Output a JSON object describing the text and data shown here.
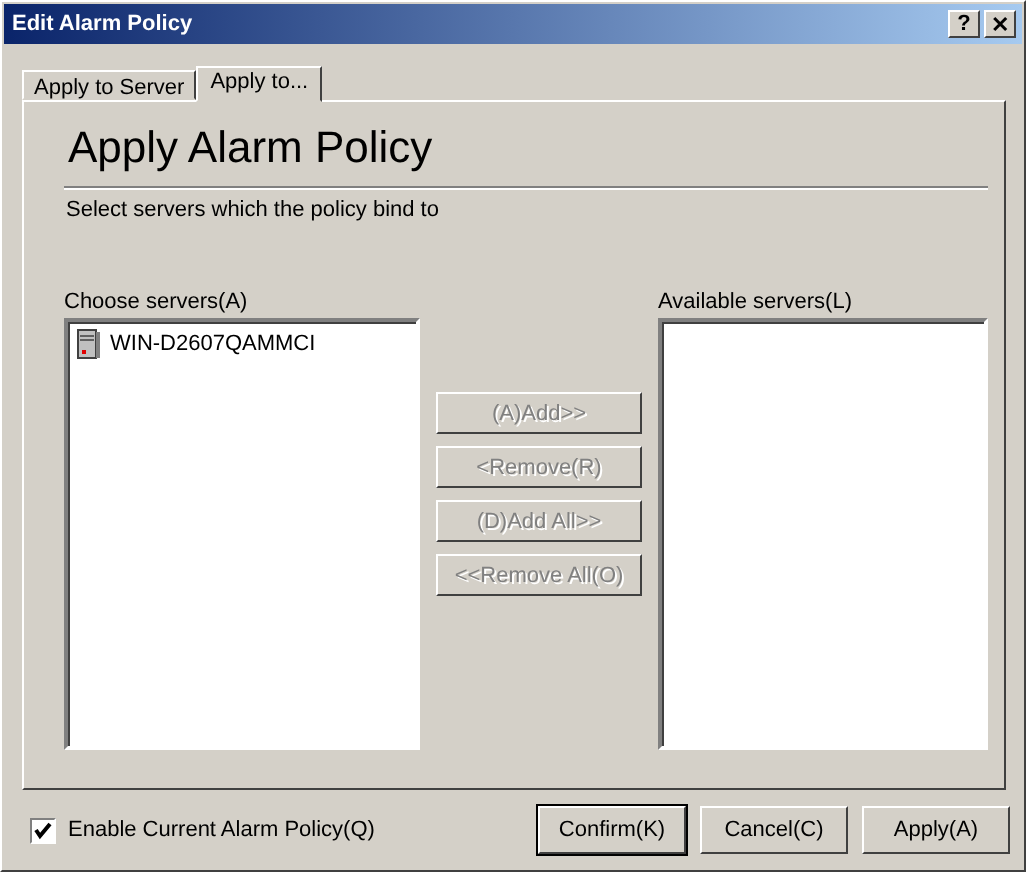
{
  "window": {
    "title": "Edit Alarm Policy",
    "help_button": "?",
    "close_button": "✕"
  },
  "tabs": [
    {
      "label": "Apply to Server",
      "selected": false
    },
    {
      "label": "Apply to...",
      "selected": true
    }
  ],
  "heading": "Apply Alarm Policy",
  "subtitle": "Select servers which the policy bind to",
  "choose_list": {
    "label": "Choose servers(A)",
    "items": [
      {
        "label": "WIN-D2607QAMMCI"
      }
    ]
  },
  "available_list": {
    "label": "Available servers(L)"
  },
  "move_buttons": [
    {
      "label": "(A)Add>>",
      "disabled": true
    },
    {
      "label": "<Remove(R)",
      "disabled": true
    },
    {
      "label": "(D)Add All>>",
      "disabled": true
    },
    {
      "label": "<<Remove All(O)",
      "disabled": true
    }
  ],
  "enable_checkbox": {
    "label": "Enable Current Alarm Policy(Q)",
    "checked": true
  },
  "buttons": [
    {
      "label": "Confirm(K)",
      "default": true
    },
    {
      "label": "Cancel(C)",
      "default": false
    },
    {
      "label": "Apply(A)",
      "default": false
    }
  ]
}
